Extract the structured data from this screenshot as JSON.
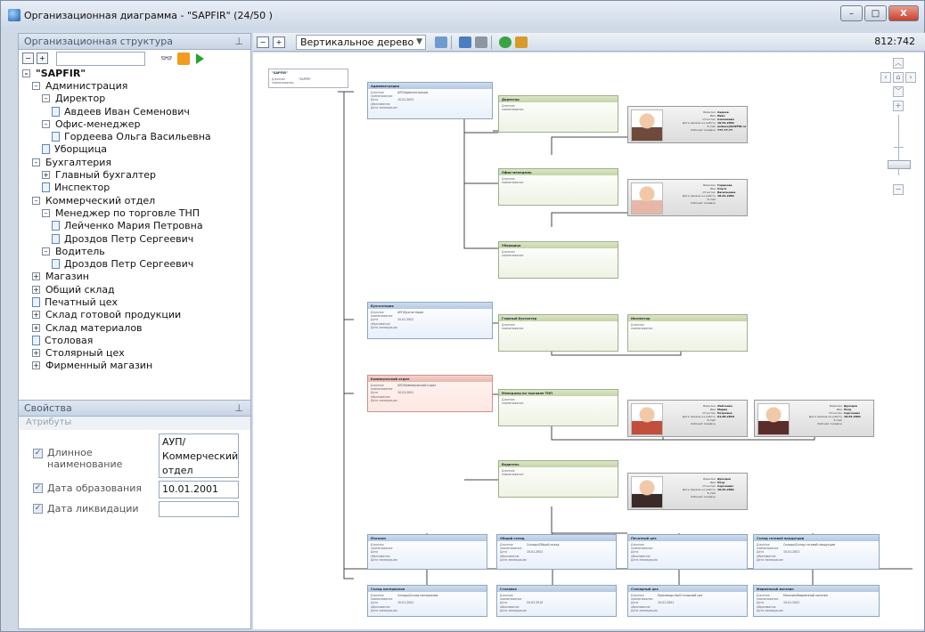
{
  "window": {
    "title": "Организационная диаграмма - \"SAPFIR\" (24/50 )",
    "minimize": "–",
    "maximize": "□",
    "close": "X"
  },
  "left": {
    "panel_title": "Организационная структура",
    "pin": "ᵠ",
    "search_value": "",
    "tree": [
      {
        "label": "\"SAPFIR\"",
        "level": 0,
        "type": "root",
        "exp": "–"
      },
      {
        "label": "Администрация",
        "level": 1,
        "exp": "–"
      },
      {
        "label": "Директор",
        "level": 2,
        "exp": "–"
      },
      {
        "label": "Авдеев Иван Семенович",
        "level": 3,
        "type": "doc"
      },
      {
        "label": "Офис-менеджер",
        "level": 2,
        "exp": "–"
      },
      {
        "label": "Гордеева Ольга Васильевна",
        "level": 3,
        "type": "doc"
      },
      {
        "label": "Уборщица",
        "level": 2,
        "type": "doc"
      },
      {
        "label": "Бухгалтерия",
        "level": 1,
        "exp": "–"
      },
      {
        "label": "Главный бухгалтер",
        "level": 2,
        "exp": "+"
      },
      {
        "label": "Инспектор",
        "level": 2,
        "type": "doc"
      },
      {
        "label": "Коммерческий отдел",
        "level": 1,
        "exp": "–"
      },
      {
        "label": "Менеджер по торговле ТНП",
        "level": 2,
        "exp": "–"
      },
      {
        "label": "Лейченко Мария Петровна",
        "level": 3,
        "type": "doc"
      },
      {
        "label": "Дроздов Петр Сергеевич",
        "level": 3,
        "type": "doc"
      },
      {
        "label": "Водитель",
        "level": 2,
        "exp": "–"
      },
      {
        "label": "Дроздов Петр Сергеевич",
        "level": 3,
        "type": "doc"
      },
      {
        "label": "Магазин",
        "level": 1,
        "exp": "+"
      },
      {
        "label": "Общий склад",
        "level": 1,
        "exp": "+"
      },
      {
        "label": "Печатный цех",
        "level": 1,
        "type": "doc"
      },
      {
        "label": "Склад готовой продукции",
        "level": 1,
        "exp": "+"
      },
      {
        "label": "Склад материалов",
        "level": 1,
        "exp": "+"
      },
      {
        "label": "Столовая",
        "level": 1,
        "type": "doc"
      },
      {
        "label": "Столярный цех",
        "level": 1,
        "exp": "+"
      },
      {
        "label": "Фирменный магазин",
        "level": 1,
        "exp": "+"
      }
    ],
    "props_title": "Свойства",
    "attributes_title": "Атрибуты",
    "props": [
      {
        "label": "Длинное наименование",
        "value": "АУП/ Коммерческий отдел",
        "checked": "✓"
      },
      {
        "label": "Дата образования",
        "value": "10.01.2001",
        "checked": "✓"
      },
      {
        "label": "Дата ликвидации",
        "value": "",
        "checked": "✓"
      }
    ]
  },
  "toolbar": {
    "view_mode": "Вертикальное дерево",
    "coords": "812:742"
  },
  "diagram": {
    "field_long": "Длинное наименование",
    "field_created": "Дата образования",
    "field_liquidated": "Дата ликвидации",
    "root": {
      "title": "\"SAPFIR\"",
      "long": "\"SAPFIR\""
    },
    "depts": [
      {
        "title": "Администрация",
        "long": "АУП/Администрация",
        "date": "10.01.2001"
      },
      {
        "title": "Бухгалтерия",
        "long": "АУП/Бухгалтерия",
        "date": "10.01.2001"
      },
      {
        "title": "Коммерческий отдел",
        "long": "АУП/Коммерческий отдел",
        "date": "10.01.2001"
      }
    ],
    "positions": [
      {
        "title": "Директор"
      },
      {
        "title": "Офис-менеджер"
      },
      {
        "title": "Уборщица"
      },
      {
        "title": "Главный бухгалтер"
      },
      {
        "title": "Инспектор"
      },
      {
        "title": "Менеджер по торговле ТНП"
      },
      {
        "title": "Водитель"
      }
    ],
    "persons": [
      {
        "surname": "Авдеев",
        "name": "Иван",
        "patronymic": "Семенович",
        "hired": "10.01.2001",
        "email": "avdeev@SAPFIR.ru",
        "phone": "777-77-77"
      },
      {
        "surname": "Гордеева",
        "name": "Ольга",
        "patronymic": "Васильевна",
        "hired": "10.01.2001",
        "email": "",
        "phone": ""
      },
      {
        "surname": "Лейченко",
        "name": "Мария",
        "patronymic": "Петровна",
        "hired": "01.06.2010",
        "email": "",
        "phone": ""
      },
      {
        "surname": "Дроздов",
        "name": "Петр",
        "patronymic": "Сергеевич",
        "hired": "10.01.2001",
        "email": "",
        "phone": ""
      },
      {
        "surname": "Дроздов",
        "name": "Петр",
        "patronymic": "Сергеевич",
        "hired": "10.01.2001",
        "email": "",
        "phone": ""
      }
    ],
    "person_labels": {
      "surname": "Фамилия",
      "name": "Имя",
      "patronymic": "Отчество",
      "hired": "Дата приема на работу",
      "email": "E-mail",
      "phone": "Рабочий телефон"
    },
    "bottom": [
      {
        "title": "Магазин",
        "long": "",
        "date": ""
      },
      {
        "title": "Общий склад",
        "long": "Склады/Общий склад",
        "date": "10.01.2001"
      },
      {
        "title": "Печатный цех",
        "long": "",
        "date": ""
      },
      {
        "title": "Склад готовой продукции",
        "long": "Склады/Склад готовой продукции",
        "date": "10.01.2001"
      },
      {
        "title": "Склад материалов",
        "long": "Склады/Склад материалов",
        "date": "10.01.2001"
      },
      {
        "title": "Столовая",
        "long": "",
        "date": "24.02.2015"
      },
      {
        "title": "Столярный цех",
        "long": "Производство/Столярный цех",
        "date": "10.01.2001"
      },
      {
        "title": "Фирменный магазин",
        "long": "Магазин/Фирменный магазин",
        "date": "10.01.2001"
      }
    ]
  }
}
